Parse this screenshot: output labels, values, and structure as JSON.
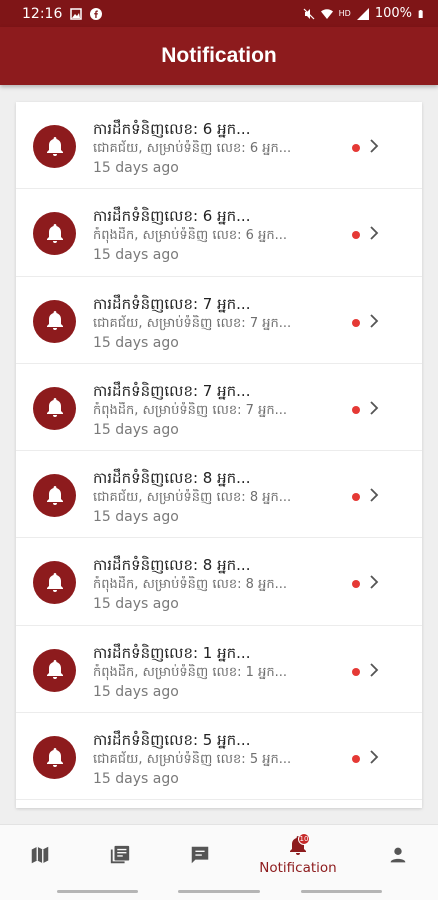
{
  "status_bar": {
    "time": "12:16",
    "network": "HD",
    "battery": "100%"
  },
  "header": {
    "title": "Notification"
  },
  "notifications": [
    {
      "title": "ការដឹកទំនិញលេខ: 6 អ្នក...",
      "body": "ជោគជ័យ, សម្រាប់ទំនិញ លេខ: 6 អ្នក...",
      "time": "15 days ago"
    },
    {
      "title": "ការដឹកទំនិញលេខ: 6 អ្នក...",
      "body": "កំពុងដឹក, សម្រាប់ទំនិញ លេខ: 6 អ្នក...",
      "time": "15 days ago"
    },
    {
      "title": "ការដឹកទំនិញលេខ: 7 អ្នក...",
      "body": "ជោគជ័យ, សម្រាប់ទំនិញ លេខ: 7 អ្នក...",
      "time": "15 days ago"
    },
    {
      "title": "ការដឹកទំនិញលេខ: 7 អ្នក...",
      "body": "កំពុងដឹក, សម្រាប់ទំនិញ លេខ: 7 អ្នក...",
      "time": "15 days ago"
    },
    {
      "title": "ការដឹកទំនិញលេខ: 8 អ្នក...",
      "body": "ជោគជ័យ, សម្រាប់ទំនិញ លេខ: 8 អ្នក...",
      "time": "15 days ago"
    },
    {
      "title": "ការដឹកទំនិញលេខ: 8 អ្នក...",
      "body": "កំពុងដឹក, សម្រាប់ទំនិញ លេខ: 8 អ្នក...",
      "time": "15 days ago"
    },
    {
      "title": "ការដឹកទំនិញលេខ: 1 អ្នក...",
      "body": "កំពុងដឹក, សម្រាប់ទំនិញ លេខ: 1 អ្នក...",
      "time": "15 days ago"
    },
    {
      "title": "ការដឹកទំនិញលេខ: 5 អ្នក...",
      "body": "ជោគជ័យ, សម្រាប់ទំនិញ លេខ: 5 អ្នក...",
      "time": "15 days ago"
    }
  ],
  "bottom_nav": {
    "items": [
      {
        "icon": "map-icon",
        "label": ""
      },
      {
        "icon": "library-icon",
        "label": ""
      },
      {
        "icon": "chat-icon",
        "label": ""
      },
      {
        "icon": "bell-icon",
        "label": "Notification",
        "badge": "10"
      },
      {
        "icon": "person-icon",
        "label": ""
      }
    ]
  },
  "colors": {
    "primary": "#8d1b1d",
    "status_bar": "#7f1517",
    "unread_dot": "#e53935"
  }
}
